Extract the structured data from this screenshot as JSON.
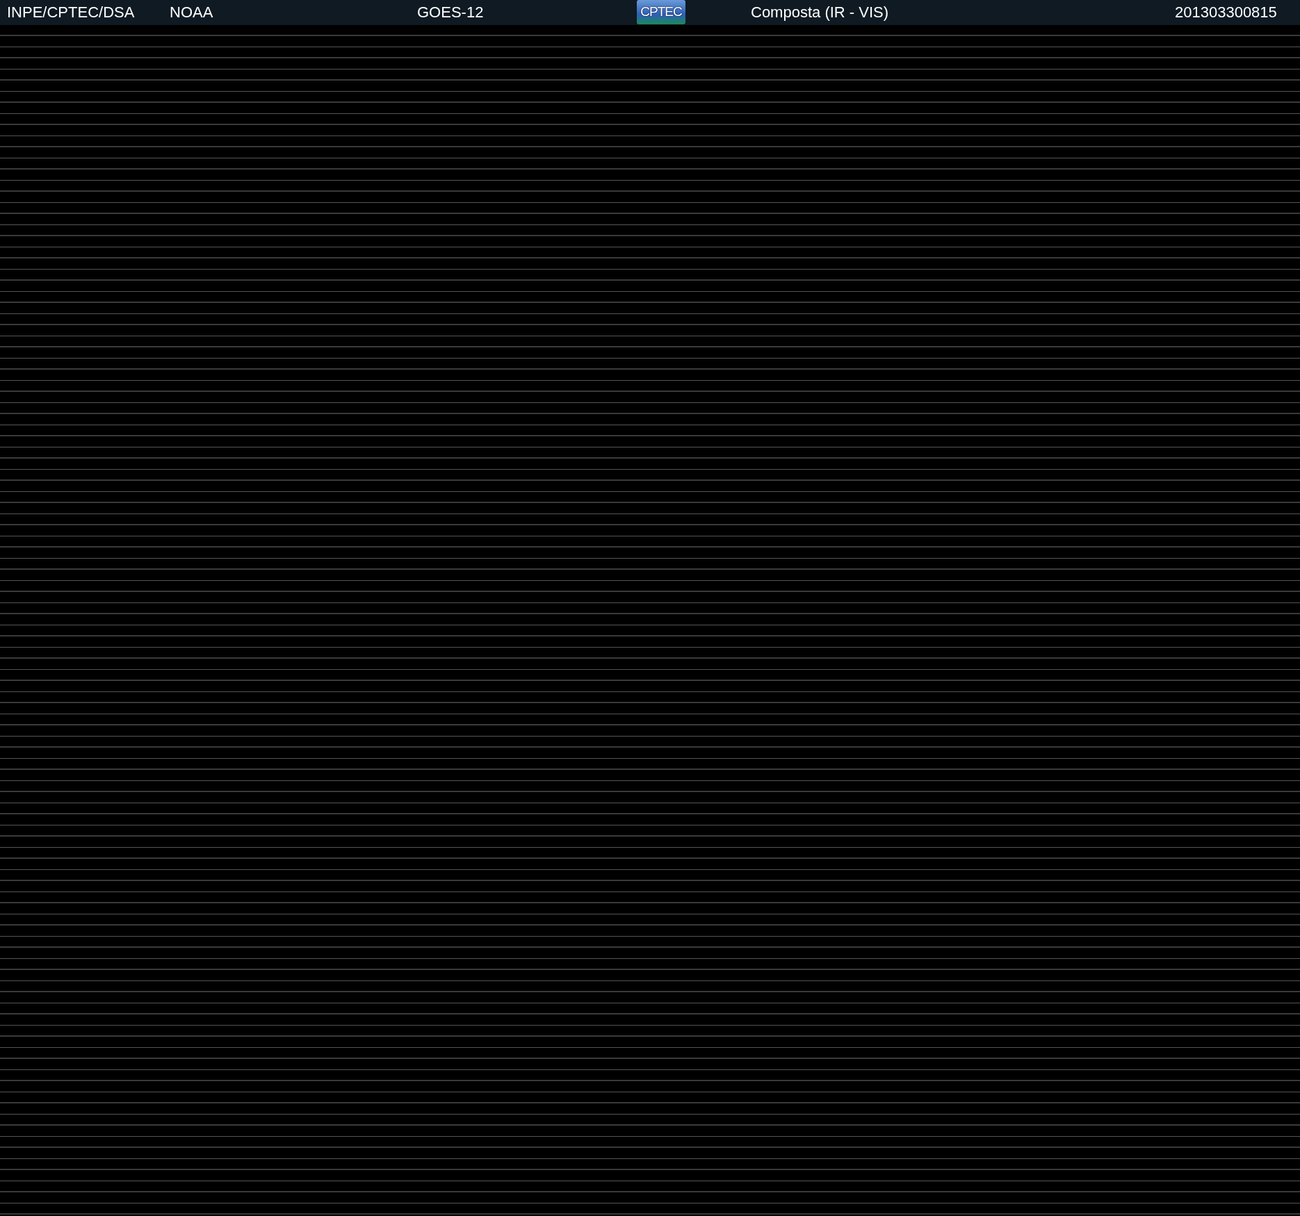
{
  "header": {
    "items": [
      {
        "kind": "text",
        "text": "INPE/CPTEC/DSA"
      },
      {
        "kind": "text",
        "text": "NOAA"
      },
      {
        "kind": "text",
        "text": "GOES-12"
      },
      {
        "kind": "logo",
        "text": "CPTEC"
      },
      {
        "kind": "text",
        "text": "Composta (IR - VIS)"
      },
      {
        "kind": "text",
        "text": "201303300815"
      }
    ]
  }
}
